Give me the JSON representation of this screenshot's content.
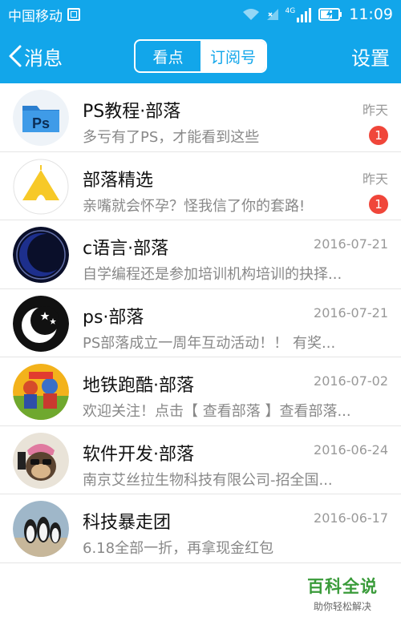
{
  "status_bar": {
    "carrier": "中国移动",
    "network": "4G",
    "time": "11:09"
  },
  "header": {
    "back_label": "消息",
    "tabs": [
      {
        "label": "看点",
        "active": true
      },
      {
        "label": "订阅号",
        "active": false
      }
    ],
    "settings_label": "设置"
  },
  "conversations": [
    {
      "title": "PS教程·部落",
      "preview": "多亏有了PS，才能看到这些",
      "date": "昨天",
      "unread": "1",
      "avatar_icon": "ps-logo-icon"
    },
    {
      "title": "部落精选",
      "preview": "亲嘴就会怀孕？怪我信了你的套路!",
      "date": "昨天",
      "unread": "1",
      "avatar_icon": "yellow-tent-icon"
    },
    {
      "title": "c语言·部落",
      "preview": "自学编程还是参加培训机构培训的抉择...",
      "date": "2016-07-21",
      "unread": null,
      "avatar_icon": "blue-crescent-icon"
    },
    {
      "title": "ps·部落",
      "preview": "PS部落成立一周年互动活动！！ 有奖...",
      "date": "2016-07-21",
      "unread": null,
      "avatar_icon": "moon-stars-icon"
    },
    {
      "title": "地铁跑酷·部落",
      "preview": "欢迎关注！点击【 查看部落 】查看部落...",
      "date": "2016-07-02",
      "unread": null,
      "avatar_icon": "subway-surfers-icon"
    },
    {
      "title": "软件开发·部落",
      "preview": "南京艾丝拉生物科技有限公司-招全国...",
      "date": "2016-06-24",
      "unread": null,
      "avatar_icon": "monkey-icon"
    },
    {
      "title": "科技暴走团",
      "preview": "6.18全部一折，再拿现金红包",
      "date": "2016-06-17",
      "unread": null,
      "avatar_icon": "penguins-icon"
    }
  ],
  "watermark": {
    "main": "百科全说",
    "sub": "助你轻松解决"
  },
  "colors": {
    "primary": "#12a6ea",
    "badge": "#f0463a",
    "watermark": "#3a9b3a"
  }
}
